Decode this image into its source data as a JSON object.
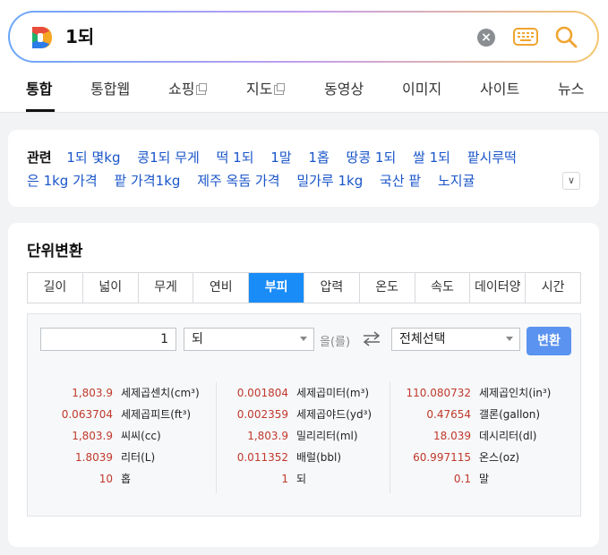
{
  "search": {
    "query": "1되"
  },
  "tabs": [
    {
      "label": "통합"
    },
    {
      "label": "통합웹"
    },
    {
      "label": "쇼핑"
    },
    {
      "label": "지도"
    },
    {
      "label": "동영상"
    },
    {
      "label": "이미지"
    },
    {
      "label": "사이트"
    },
    {
      "label": "뉴스"
    }
  ],
  "related": {
    "title": "관련",
    "line1": [
      "1되 몇kg",
      "콩1되 무게",
      "떡 1되",
      "1말",
      "1홉",
      "땅콩 1되",
      "쌀 1되",
      "팥시루떡"
    ],
    "line2": [
      "은 1kg 가격",
      "팥 가격1kg",
      "제주 옥돔 가격",
      "밀가루 1kg",
      "국산 팥",
      "노지귤"
    ]
  },
  "converter": {
    "title": "단위변환",
    "categories": [
      "길이",
      "넓이",
      "무게",
      "연비",
      "부피",
      "압력",
      "온도",
      "속도",
      "데이터양",
      "시간"
    ],
    "active_category": "부피",
    "input_value": "1",
    "from_unit": "되",
    "josa": "을(를)",
    "to_unit": "전체선택",
    "convert_label": "변환",
    "results": [
      [
        {
          "value": "1,803.9",
          "unit": "세제곱센치(cm³)"
        },
        {
          "value": "0.063704",
          "unit": "세제곱피트(ft³)"
        },
        {
          "value": "1,803.9",
          "unit": "씨씨(cc)"
        },
        {
          "value": "1.8039",
          "unit": "리터(L)"
        },
        {
          "value": "10",
          "unit": "홉"
        }
      ],
      [
        {
          "value": "0.001804",
          "unit": "세제곱미터(m³)"
        },
        {
          "value": "0.002359",
          "unit": "세제곱야드(yd³)"
        },
        {
          "value": "1,803.9",
          "unit": "밀리리터(ml)"
        },
        {
          "value": "0.011352",
          "unit": "배럴(bbl)"
        },
        {
          "value": "1",
          "unit": "되"
        }
      ],
      [
        {
          "value": "110.080732",
          "unit": "세제곱인치(in³)"
        },
        {
          "value": "0.47654",
          "unit": "갤론(gallon)"
        },
        {
          "value": "18.039",
          "unit": "데시리터(dl)"
        },
        {
          "value": "60.997115",
          "unit": "온스(oz)"
        },
        {
          "value": "0.1",
          "unit": "말"
        }
      ]
    ]
  },
  "colors": {
    "accent": "#1a8cf7",
    "link": "#1a55c9",
    "value": "#c0392b",
    "button": "#5a93f0"
  }
}
